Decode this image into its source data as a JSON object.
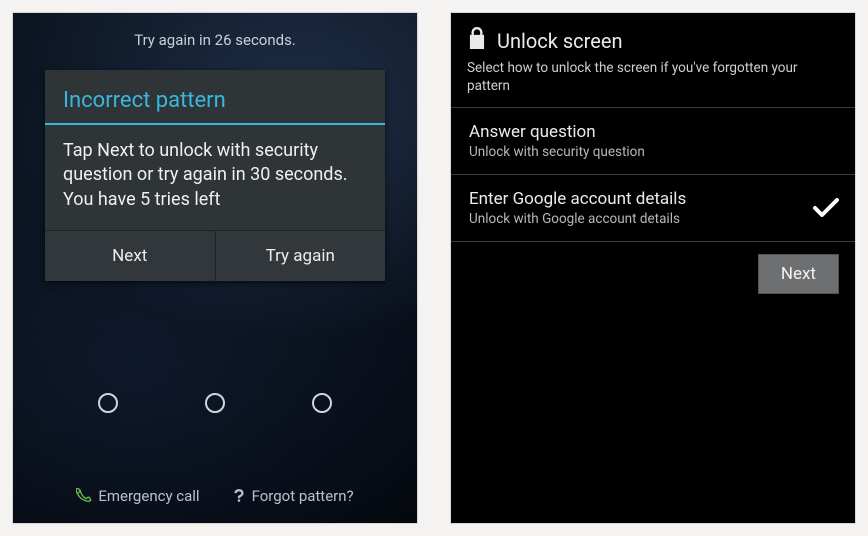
{
  "left": {
    "status": "Try again in 26 seconds.",
    "dialog": {
      "title": "Incorrect pattern",
      "body": "Tap Next to unlock with security question or try again in 30 seconds. You have 5 tries left",
      "next": "Next",
      "retry": "Try again"
    },
    "bottom": {
      "emergency": "Emergency call",
      "forgot": "Forgot pattern?"
    }
  },
  "right": {
    "header": "Unlock screen",
    "subheader": "Select how to unlock the screen if you've forgotten your pattern",
    "options": [
      {
        "title": "Answer question",
        "sub": "Unlock with security question",
        "selected": false
      },
      {
        "title": "Enter Google account details",
        "sub": "Unlock with Google account details",
        "selected": true
      }
    ],
    "next": "Next"
  }
}
